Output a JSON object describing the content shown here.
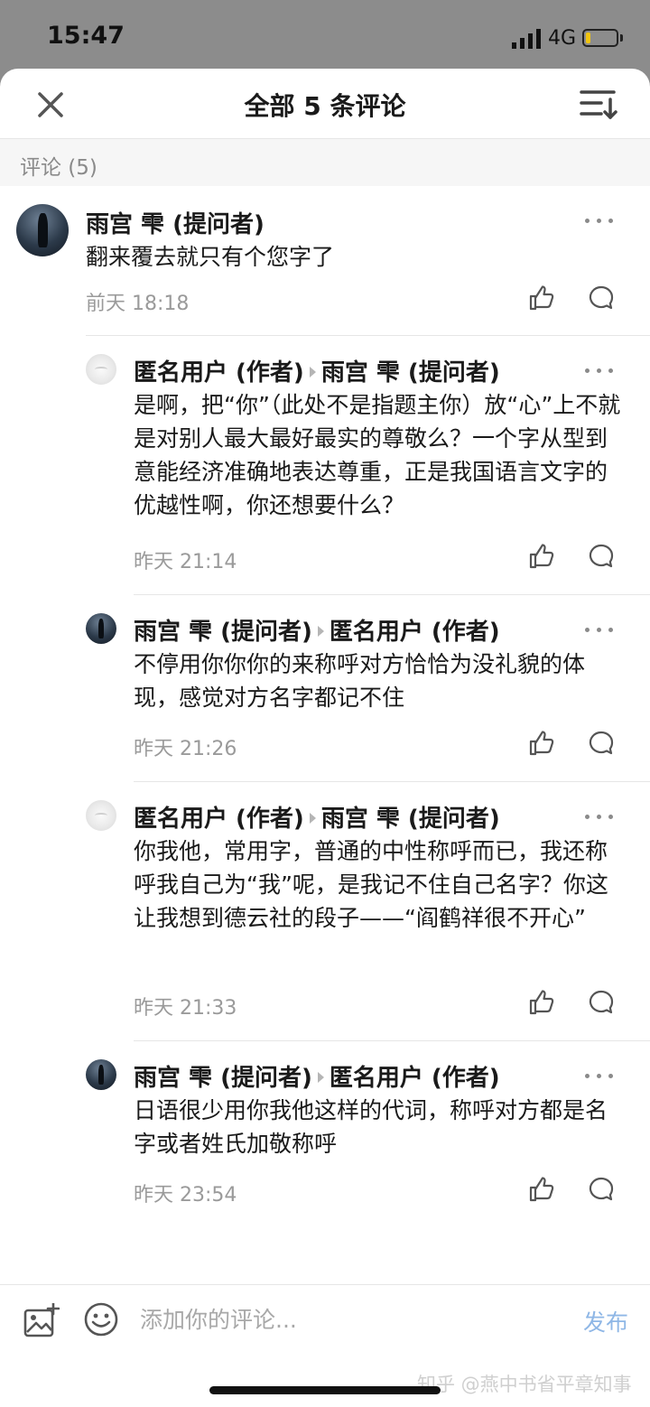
{
  "status": {
    "time": "15:47",
    "network": "4G",
    "battery_level": 0.15
  },
  "header": {
    "title": "全部 5 条评论"
  },
  "section": {
    "label": "评论 (5)"
  },
  "comments": [
    {
      "author": "雨宫 雫 (提问者)",
      "text": "翻来覆去就只有个您字了",
      "time": "前天 18:18"
    },
    {
      "author": "匿名用户 (作者)",
      "reply_to": "雨宫 雫 (提问者)",
      "text": "是啊，把“你”（此处不是指题主你）放“心”上不就是对别人最大最好最实的尊敬么？一个字从型到意能经济准确地表达尊重，正是我国语言文字的优越性啊，你还想要什么？",
      "time": "昨天 21:14"
    },
    {
      "author": "雨宫 雫 (提问者)",
      "reply_to": "匿名用户 (作者)",
      "text": "不停用你你你的来称呼对方恰恰为没礼貌的体现，感觉对方名字都记不住",
      "time": "昨天 21:26"
    },
    {
      "author": "匿名用户 (作者)",
      "reply_to": "雨宫 雫 (提问者)",
      "text": "你我他，常用字，普通的中性称呼而已，我还称呼我自己为“我”呢，是我记不住自己名字？你这让我想到德云社的段子——“阎鹤祥很不开心”",
      "time": "昨天 21:33"
    },
    {
      "author": "雨宫 雫 (提问者)",
      "reply_to": "匿名用户 (作者)",
      "text": "日语很少用你我他这样的代词，称呼对方都是名字或者姓氏加敬称呼",
      "time": "昨天 23:54"
    }
  ],
  "footer": {
    "input_placeholder": "添加你的评论...",
    "publish_label": "发布",
    "watermark": "知乎 @燕中书省平章知事"
  },
  "colors": {
    "accent_link": "#8fb7e6",
    "status_bar": "#8c8c8c",
    "battery": "#f1c40f"
  },
  "icons": {
    "close": "close-icon",
    "sort": "sort-icon",
    "more": "more-dots-icon",
    "like": "thumbs-up-icon",
    "reply": "speech-bubble-icon",
    "image": "image-add-icon",
    "emoji": "emoji-icon"
  }
}
